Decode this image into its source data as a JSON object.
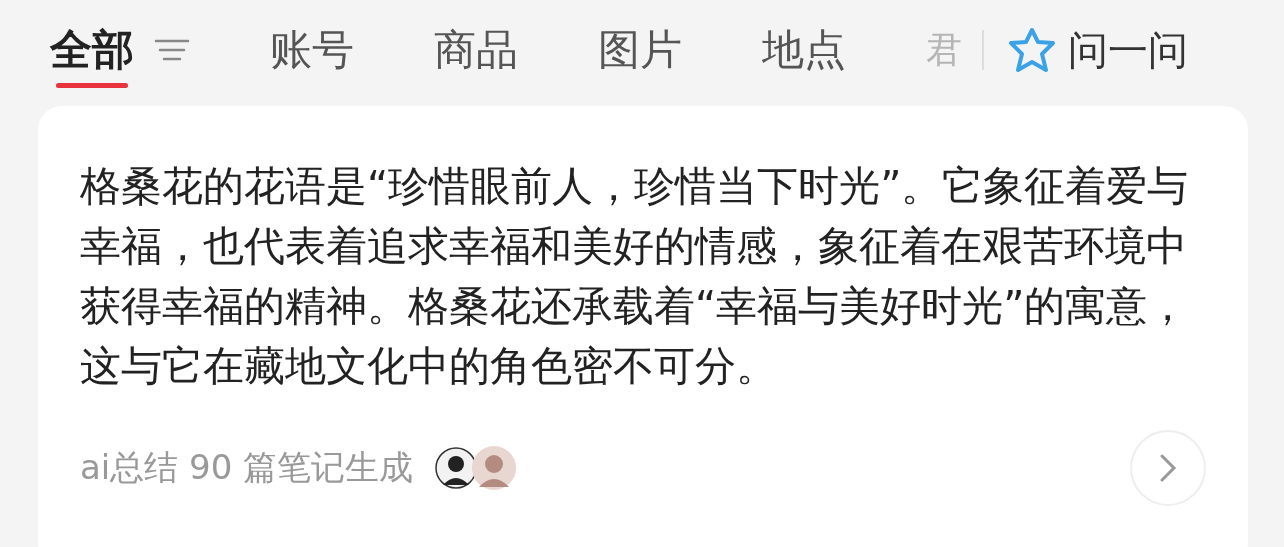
{
  "tabs": [
    {
      "label": "全部",
      "selected": true
    },
    {
      "label": "账号",
      "selected": false
    },
    {
      "label": "商品",
      "selected": false
    },
    {
      "label": "图片",
      "selected": false
    },
    {
      "label": "地点",
      "selected": false
    },
    {
      "label": "君",
      "selected": false
    }
  ],
  "ask": {
    "label": "问一问"
  },
  "answer": {
    "text": "格桑花的花语是“珍惜眼前人，珍惜当下时光”。它象征着爱与幸福，也代表着追求幸福和美好的情感，象征着在艰苦环境中获得幸福的精神。格桑花还承载着“幸福与美好时光”的寓意，这与它在藏地文化中的角色密不可分。",
    "source": "ai总结 90 篇笔记生成"
  }
}
